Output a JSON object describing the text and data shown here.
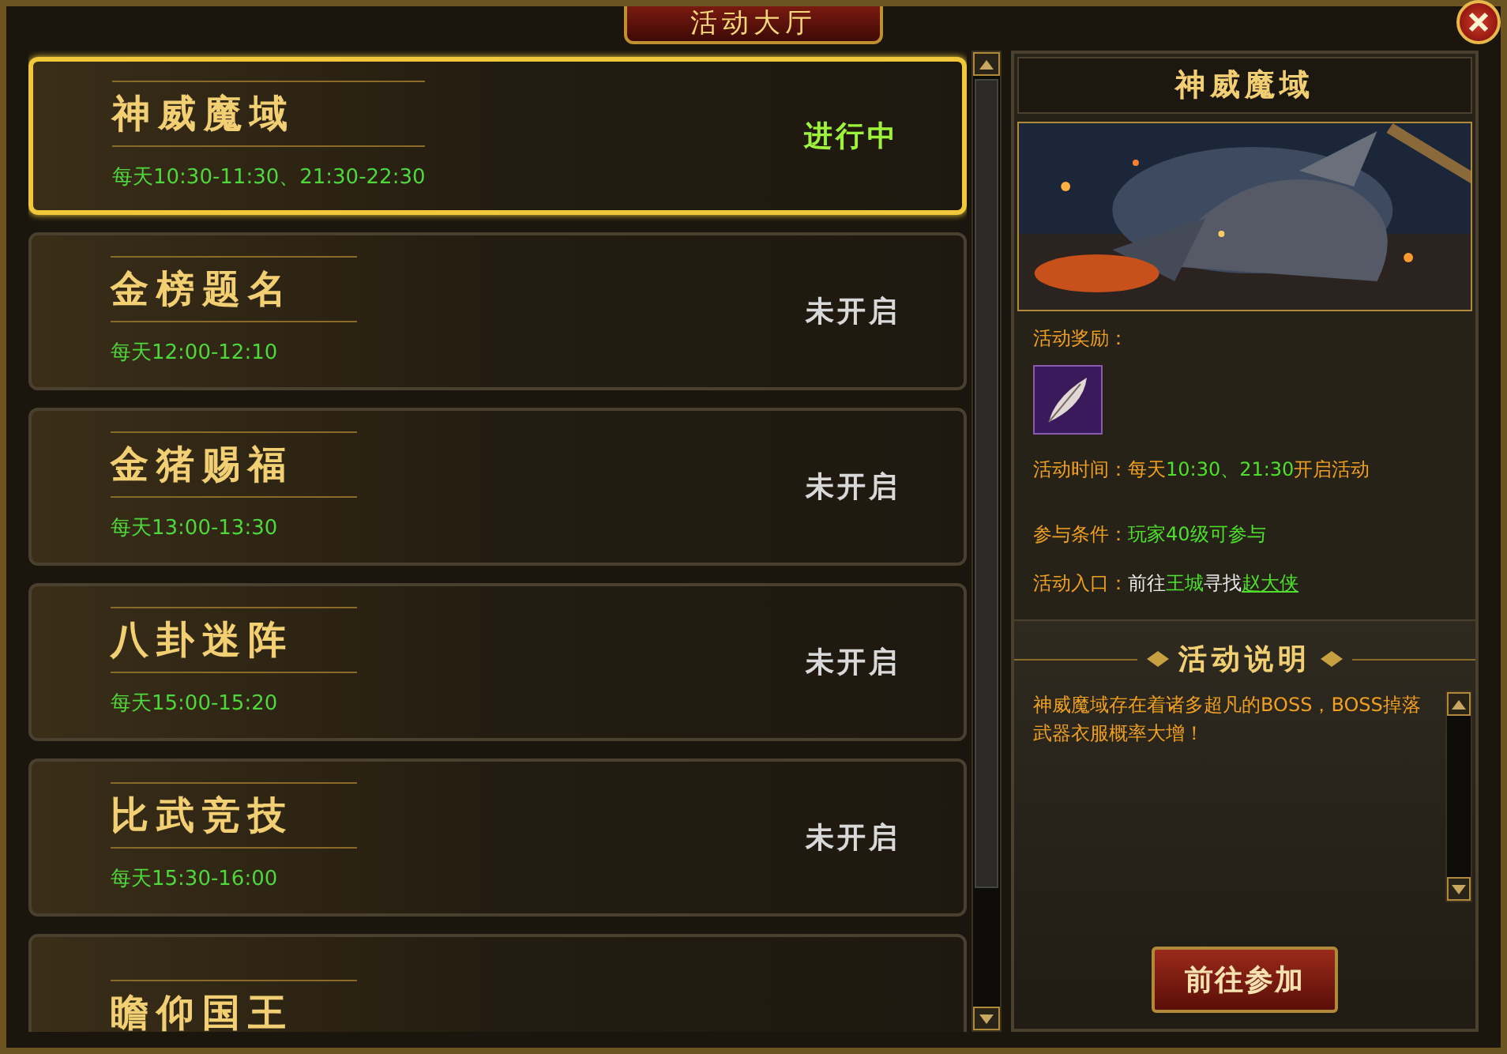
{
  "window": {
    "title": "活动大厅"
  },
  "activities": [
    {
      "name": "神威魔域",
      "schedule": "每天10:30-11:30、21:30-22:30",
      "status": "进行中",
      "color": "#9ef23a",
      "selected": true
    },
    {
      "name": "金榜题名",
      "schedule": "每天12:00-12:10",
      "status": "未开启",
      "color": "#d8d8d8",
      "selected": false
    },
    {
      "name": "金猪赐福",
      "schedule": "每天13:00-13:30",
      "status": "未开启",
      "color": "#d8d8d8",
      "selected": false
    },
    {
      "name": "八卦迷阵",
      "schedule": "每天15:00-15:20",
      "status": "未开启",
      "color": "#d8d8d8",
      "selected": false
    },
    {
      "name": "比武竞技",
      "schedule": "每天15:30-16:00",
      "status": "未开启",
      "color": "#d8d8d8",
      "selected": false
    },
    {
      "name": "瞻仰国王",
      "selected": false
    }
  ],
  "detail": {
    "title": "神威魔域",
    "reward_label": "活动奖励：",
    "lines": [
      {
        "kind": "time",
        "segments": [
          {
            "text": "活动时间：",
            "color": "#f0a020"
          },
          {
            "text": "每天",
            "color": "#f0a020"
          },
          {
            "text": "10:30、21:30",
            "color": "#4ee02a"
          },
          {
            "text": "开启活动",
            "color": "#f0a020"
          }
        ]
      },
      {
        "kind": "condition",
        "segments": [
          {
            "text": "参与条件：",
            "color": "#f0a020"
          },
          {
            "text": "玩家40级可参与",
            "color": "#4ee02a"
          }
        ]
      },
      {
        "kind": "entry",
        "segments": [
          {
            "text": "活动入口：",
            "color": "#f0a020"
          },
          {
            "text": "前往",
            "color": "#e8e8e8"
          },
          {
            "text": "王城",
            "color": "#4ee02a"
          },
          {
            "text": "寻找",
            "color": "#e8e8e8"
          },
          {
            "text": "赵大侠",
            "color": "#4ee02a",
            "kind": "link"
          }
        ]
      }
    ],
    "section_title": "活动说明",
    "description": "神威魔域存在着诸多超凡的BOSS，BOSS掉落武器衣服概率大增！",
    "join_button": "前往参加"
  }
}
